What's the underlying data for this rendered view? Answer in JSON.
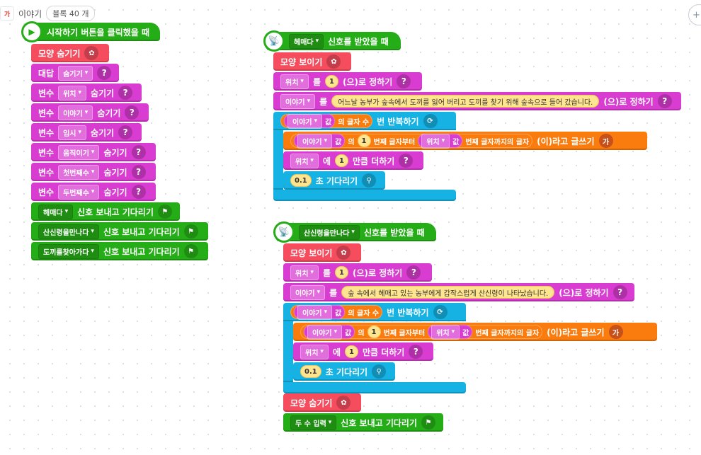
{
  "topbar": {
    "object_thumb": "가",
    "object_name": "이야기",
    "block_count": "블록 40 개"
  },
  "corner_button": "+",
  "script1": {
    "hat_label": "시작하기 버튼을 클릭했을 때",
    "b1": "모양 숨기기",
    "b2_label": "대답",
    "b2_dd": "숨기기",
    "b2_q": "?",
    "b3_label": "변수",
    "b3_dd": "위치",
    "b3_suffix": "숨기기",
    "b4_label": "변수",
    "b4_dd": "이야기",
    "b4_suffix": "숨기기",
    "b5_label": "변수",
    "b5_dd": "임시",
    "b5_suffix": "숨기기",
    "b6_label": "변수",
    "b6_dd": "움직이기",
    "b6_suffix": "숨기기",
    "b7_label": "변수",
    "b7_dd": "첫번째수",
    "b7_suffix": "숨기기",
    "b8_label": "변수",
    "b8_dd": "두번째수",
    "b8_suffix": "숨기기",
    "g1_dd": "헤매다",
    "g1_label": "신호 보내고 기다리기",
    "g2_dd": "산신령을만나다",
    "g2_label": "신호 보내고 기다리기",
    "g3_dd": "도끼를찾아가다",
    "g3_label": "신호 보내고 기다리기"
  },
  "script2": {
    "hat_dd": "헤매다",
    "hat_label": "신호를 받았을 때",
    "show": "모양 보이기",
    "set1_dd": "위치",
    "set1_mid": "를",
    "set1_num": "1",
    "set1_suffix": "(으)로 정하기",
    "set2_dd": "이야기",
    "set2_mid": "를",
    "set2_str": "어느날 농부가 숲속에서 도끼를 잃어 버리고 도끼를 찾기 위해 숲속으로 들어 갔습니다.",
    "set2_suffix": "(으)로 정하기",
    "loop_var": "이야기",
    "loop_val": "값",
    "loop_len": "의 글자 수",
    "loop_label": "번 반복하기",
    "write_var": "이야기",
    "write_val": "값",
    "write_of": "의",
    "write_num": "1",
    "write_from": "번째 글자부터",
    "write_var2": "위치",
    "write_val2": "값",
    "write_to": "번째 글자까지의 글자",
    "write_suffix": "(이)라고 글쓰기",
    "write_ico": "가",
    "add_dd": "위치",
    "add_mid": "에",
    "add_num": "1",
    "add_suffix": "만큼 더하기",
    "wait_num": "0.1",
    "wait_label": "초 기다리기"
  },
  "script3": {
    "hat_dd": "산신령을만나다",
    "hat_label": "신호를 받았을 때",
    "show": "모양 보이기",
    "set1_dd": "위치",
    "set1_mid": "를",
    "set1_num": "1",
    "set1_suffix": "(으)로 정하기",
    "set2_dd": "이야기",
    "set2_mid": "를",
    "set2_str": "숲 속에서 헤매고 있는 농부에게 갑작스럽게 산신령이 나타났습니다.",
    "set2_suffix": "(으)로 정하기",
    "loop_var": "이야기",
    "loop_val": "값",
    "loop_len": "의 글자 수",
    "loop_label": "번 반복하기",
    "write_var": "이야기",
    "write_val": "값",
    "write_of": "의",
    "write_num": "1",
    "write_from": "번째 글자부터",
    "write_var2": "위치",
    "write_val2": "값",
    "write_to": "번째 글자까지의 글자",
    "write_suffix": "(이)라고 글쓰기",
    "write_ico": "가",
    "add_dd": "위치",
    "add_mid": "에",
    "add_num": "1",
    "add_suffix": "만큼 더하기",
    "wait_num": "0.1",
    "wait_label": "초 기다리기",
    "hide": "모양 숨기기",
    "send_dd": "두 수 입력",
    "send_label": "신호 보내고 기다리기"
  },
  "colors": {
    "looks": "#f54d5e",
    "data": "#d93cd1",
    "start": "#25ad17",
    "flow": "#15b2e3",
    "text": "#fb7c0e"
  }
}
